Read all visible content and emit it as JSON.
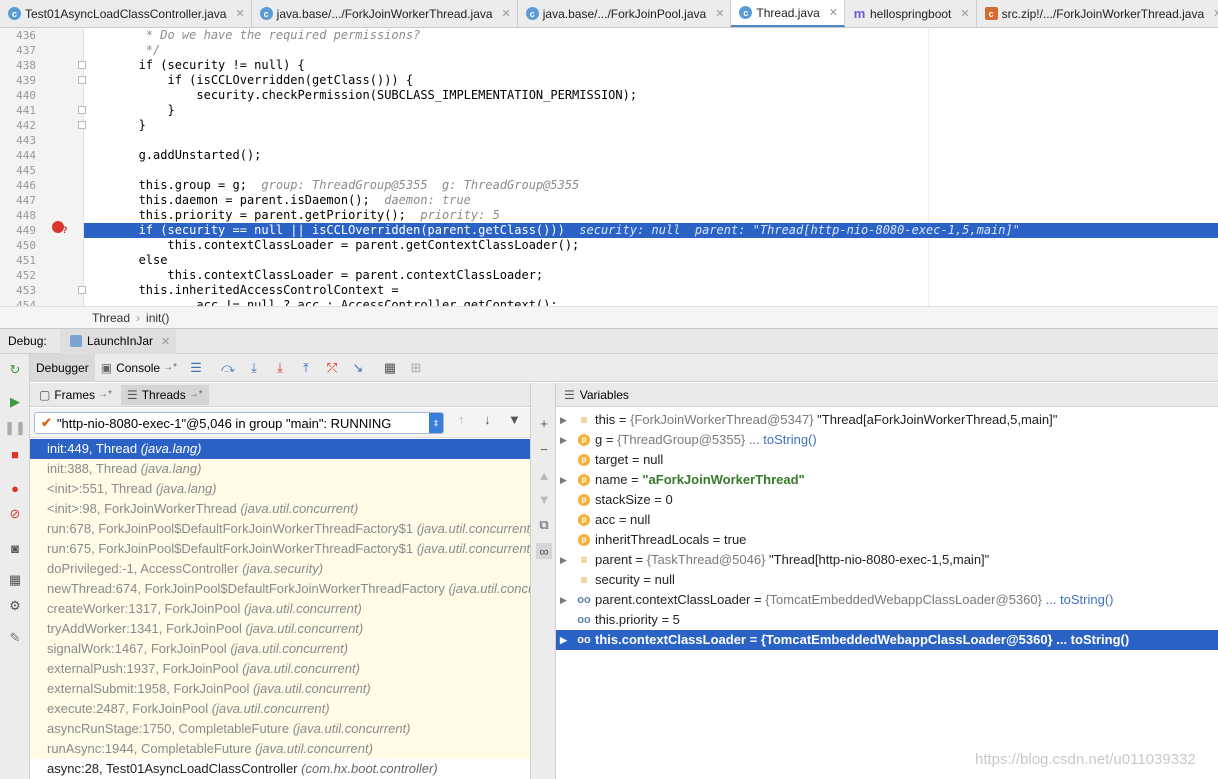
{
  "tabs": [
    {
      "label": "Test01AsyncLoadClassController.java",
      "icon": "class-icon"
    },
    {
      "label": "java.base/.../ForkJoinWorkerThread.java",
      "icon": "class-icon"
    },
    {
      "label": "java.base/.../ForkJoinPool.java",
      "icon": "class-icon"
    },
    {
      "label": "Thread.java",
      "icon": "class-icon",
      "active": true
    },
    {
      "label": "hellospringboot",
      "icon": "module-icon"
    },
    {
      "label": "src.zip!/.../ForkJoinWorkerThread.java",
      "icon": "zip-class-icon"
    }
  ],
  "editor": {
    "lines": [
      {
        "n": "436",
        "t": "        * Do we have the required permissions?",
        "c": true
      },
      {
        "n": "437",
        "t": "        */",
        "c": true
      },
      {
        "n": "438",
        "t": "       if (security != null) {"
      },
      {
        "n": "439",
        "t": "           if (isCCLOverridden(getClass())) {"
      },
      {
        "n": "440",
        "t": "               security.checkPermission(SUBCLASS_IMPLEMENTATION_PERMISSION);"
      },
      {
        "n": "441",
        "t": "           }"
      },
      {
        "n": "442",
        "t": "       }"
      },
      {
        "n": "443",
        "t": ""
      },
      {
        "n": "444",
        "t": "       g.addUnstarted();"
      },
      {
        "n": "445",
        "t": ""
      },
      {
        "n": "446",
        "t": "       this.group = g;",
        "h": "  group: ThreadGroup@5355  g: ThreadGroup@5355"
      },
      {
        "n": "447",
        "t": "       this.daemon = parent.isDaemon();",
        "h": "  daemon: true"
      },
      {
        "n": "448",
        "t": "       this.priority = parent.getPriority();",
        "h": "  priority: 5"
      },
      {
        "n": "449",
        "t": "       if (security == null || isCCLOverridden(parent.getClass()))",
        "h": "  security: null  parent: \"Thread[http-nio-8080-exec-1,5,main]\"",
        "sel": true
      },
      {
        "n": "450",
        "t": "           this.contextClassLoader = parent.getContextClassLoader();"
      },
      {
        "n": "451",
        "t": "       else"
      },
      {
        "n": "452",
        "t": "           this.contextClassLoader = parent.contextClassLoader;"
      },
      {
        "n": "453",
        "t": "       this.inheritedAccessControlContext ="
      },
      {
        "n": "454",
        "t": "               acc != null ? acc : AccessController.getContext();"
      }
    ]
  },
  "breadcrumb": {
    "class": "Thread",
    "method": "init()"
  },
  "debug": {
    "label": "Debug:",
    "config": "LaunchInJar"
  },
  "debugger_tabs": {
    "debugger": "Debugger",
    "console": "Console",
    "console_suffix": "→*"
  },
  "frames_panel": {
    "frames": "Frames",
    "threads": "Threads",
    "suffix": "→*"
  },
  "thread_selector": {
    "value": "\"http-nio-8080-exec-1\"@5,046 in group \"main\": RUNNING"
  },
  "frames": [
    {
      "m": "init:449, Thread",
      "p": "(java.lang)",
      "sel": true
    },
    {
      "m": "init:388, Thread",
      "p": "(java.lang)"
    },
    {
      "m": "<init>:551, Thread",
      "p": "(java.lang)"
    },
    {
      "m": "<init>:98, ForkJoinWorkerThread",
      "p": "(java.util.concurrent)"
    },
    {
      "m": "run:678, ForkJoinPool$DefaultForkJoinWorkerThreadFactory$1",
      "p": "(java.util.concurrent)"
    },
    {
      "m": "run:675, ForkJoinPool$DefaultForkJoinWorkerThreadFactory$1",
      "p": "(java.util.concurrent)"
    },
    {
      "m": "doPrivileged:-1, AccessController",
      "p": "(java.security)"
    },
    {
      "m": "newThread:674, ForkJoinPool$DefaultForkJoinWorkerThreadFactory",
      "p": "(java.util.concurrent)"
    },
    {
      "m": "createWorker:1317, ForkJoinPool",
      "p": "(java.util.concurrent)"
    },
    {
      "m": "tryAddWorker:1341, ForkJoinPool",
      "p": "(java.util.concurrent)"
    },
    {
      "m": "signalWork:1467, ForkJoinPool",
      "p": "(java.util.concurrent)"
    },
    {
      "m": "externalPush:1937, ForkJoinPool",
      "p": "(java.util.concurrent)"
    },
    {
      "m": "externalSubmit:1958, ForkJoinPool",
      "p": "(java.util.concurrent)"
    },
    {
      "m": "execute:2487, ForkJoinPool",
      "p": "(java.util.concurrent)"
    },
    {
      "m": "asyncRunStage:1750, CompletableFuture",
      "p": "(java.util.concurrent)"
    },
    {
      "m": "runAsync:1944, CompletableFuture",
      "p": "(java.util.concurrent)"
    },
    {
      "m": "async:28, Test01AsyncLoadClassController",
      "p": "(com.hx.boot.controller)",
      "user": true
    }
  ],
  "variables_title": "Variables",
  "variables": [
    {
      "name": "this",
      "rest": " = ",
      "ty": "{ForkJoinWorkerThread@5347}",
      "val": " \"Thread[aForkJoinWorkerThread,5,main]\"",
      "icon": "list",
      "arrow": true
    },
    {
      "name": "g",
      "rest": " = ",
      "ty": "{ThreadGroup@5355}",
      "lnk": " ... toString()",
      "icon": "p",
      "arrow": true
    },
    {
      "name": "target",
      "rest": " = null",
      "icon": "p"
    },
    {
      "name": "name",
      "rest": " = ",
      "str": "\"aForkJoinWorkerThread\"",
      "icon": "p",
      "arrow": true
    },
    {
      "name": "stackSize",
      "rest": " = 0",
      "icon": "p"
    },
    {
      "name": "acc",
      "rest": " = null",
      "icon": "p"
    },
    {
      "name": "inheritThreadLocals",
      "rest": " = true",
      "icon": "p"
    },
    {
      "name": "parent",
      "rest": " = ",
      "ty": "{TaskThread@5046}",
      "val": " \"Thread[http-nio-8080-exec-1,5,main]\"",
      "icon": "list",
      "arrow": true
    },
    {
      "name": "security",
      "rest": " = null",
      "icon": "list"
    },
    {
      "name": "parent.contextClassLoader",
      "rest": " = ",
      "ty": "{TomcatEmbeddedWebappClassLoader@5360}",
      "lnk": " ... toString()",
      "icon": "oo",
      "arrow": true
    },
    {
      "name": "this.priority",
      "rest": " = 5",
      "icon": "oo"
    },
    {
      "name": "this.contextClassLoader",
      "rest": " = ",
      "ty": "{TomcatEmbeddedWebappClassLoader@5360}",
      "lnk": " ... toString()",
      "icon": "oo",
      "arrow": true,
      "sel": true
    }
  ],
  "watermark": "https://blog.csdn.net/u011039332"
}
